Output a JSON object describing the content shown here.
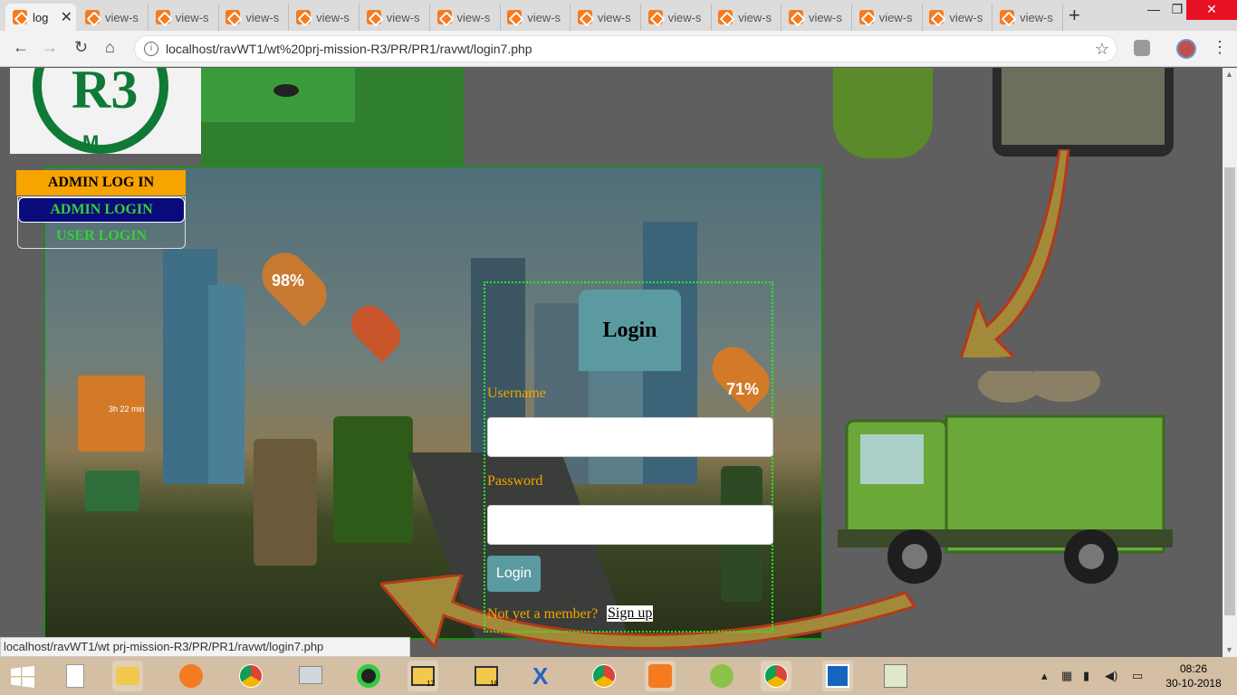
{
  "browser": {
    "active_tab_title": "log",
    "tabs": [
      "view-s",
      "view-s",
      "view-s",
      "view-s",
      "view-s",
      "view-s",
      "view-s",
      "view-s",
      "view-s",
      "view-s",
      "view-s",
      "view-s",
      "view-s",
      "view-s"
    ],
    "address": "localhost/ravWT1/wt%20prj-mission-R3/PR/PR1/ravwt/login7.php",
    "status_url": "localhost/ravWT1/wt prj-mission-R3/PR/PR1/ravwt/login7.php"
  },
  "menu": {
    "header": "ADMIN LOG IN",
    "admin_login": "ADMIN LOGIN",
    "user_login": "USER LOGIN"
  },
  "login": {
    "title": "Login",
    "username_label": "Username",
    "password_label": "Password",
    "username_value": "",
    "password_value": "",
    "submit_label": "Login",
    "member_text": "Not yet a member?",
    "signup_label": "Sign up"
  },
  "scene": {
    "pct1": "98%",
    "pct2": "71%",
    "timer": "3h 22 min"
  },
  "taskbar": {
    "time": "08:26",
    "date": "30-10-2018",
    "badge1": "17",
    "badge2": "18"
  },
  "colors": {
    "accent_orange": "#f7a300",
    "teal": "#5a9aa0",
    "menu_green": "#34d134",
    "menu_navy": "#0a0a7a",
    "form_border": "#1bff1b"
  }
}
